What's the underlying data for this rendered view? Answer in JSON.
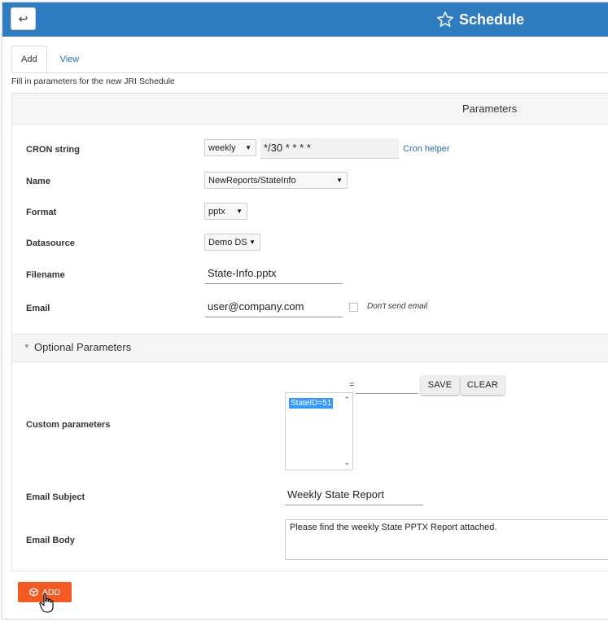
{
  "header": {
    "back_icon": "return-arrow-icon",
    "back_glyph": "↩",
    "title": "Schedule",
    "title_icon": "star-icon",
    "color": "#2f7cc0"
  },
  "tabs": [
    {
      "label": "Add",
      "active": true
    },
    {
      "label": "View",
      "active": false
    }
  ],
  "intro": "Fill in parameters for the new JRI Schedule",
  "parameters": {
    "title": "Parameters",
    "cron": {
      "label": "CRON string",
      "frequency": "weekly",
      "value": "*/30 * * * *",
      "helper_link": "Cron helper"
    },
    "name": {
      "label": "Name",
      "value": "NewReports/StateInfo"
    },
    "format": {
      "label": "Format",
      "value": "pptx"
    },
    "datasource": {
      "label": "Datasource",
      "value": "Demo DS"
    },
    "filename": {
      "label": "Filename",
      "value": "State-Info.pptx"
    },
    "email": {
      "label": "Email",
      "value": "user@company.com",
      "dont_send_label": "Don't send email",
      "dont_send_checked": false
    }
  },
  "optional": {
    "title": "Optional Parameters",
    "custom": {
      "label": "Custom parameters",
      "key": "",
      "equals": "=",
      "value": "",
      "save_label": "SAVE",
      "clear_label": "CLEAR",
      "items": [
        "StateID=51"
      ]
    },
    "email_subject": {
      "label": "Email Subject",
      "value": "Weekly State Report"
    },
    "email_body": {
      "label": "Email Body",
      "value": "Please find the weekly State PPTX Report attached."
    }
  },
  "add_button": {
    "label": "ADD",
    "icon": "cube-icon",
    "color": "#f15a22"
  }
}
